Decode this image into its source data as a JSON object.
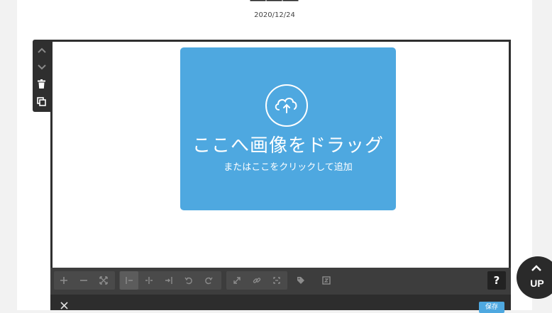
{
  "post": {
    "date": "2020/12/24"
  },
  "side_toolbar": {
    "items": [
      {
        "icon": "chevron-up-icon"
      },
      {
        "icon": "chevron-down-icon"
      },
      {
        "icon": "trash-icon"
      },
      {
        "icon": "duplicate-icon"
      }
    ]
  },
  "dropzone": {
    "icon": "cloud-upload-icon",
    "main_text": "ここへ画像をドラッグ",
    "sub_text": "またはここをクリックして追加"
  },
  "image_toolbar": {
    "buttons": [
      {
        "icon": "zoom-in-icon"
      },
      {
        "icon": "zoom-out-icon"
      },
      {
        "icon": "fit-icon"
      },
      {
        "icon": "align-left-icon",
        "active": true
      },
      {
        "icon": "align-center-icon"
      },
      {
        "icon": "align-right-icon"
      },
      {
        "icon": "rotate-left-icon"
      },
      {
        "icon": "rotate-right-icon"
      },
      {
        "icon": "resize-icon"
      },
      {
        "icon": "link-icon"
      },
      {
        "icon": "unlink-icon"
      },
      {
        "icon": "tag-icon"
      },
      {
        "icon": "caption-icon"
      }
    ],
    "help_label": "?"
  },
  "footer": {
    "save_label": "保存"
  },
  "up_button": {
    "label": "UP"
  },
  "colors": {
    "accent": "#4ea8e0",
    "toolbar": "#3d3d3d",
    "dark": "#2f2f2f"
  }
}
